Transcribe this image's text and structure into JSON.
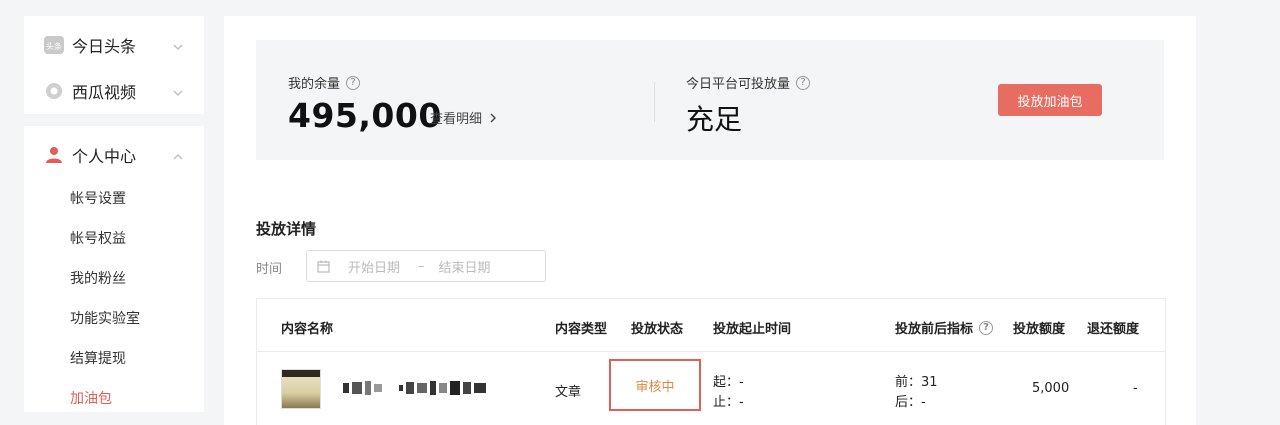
{
  "sidebar": {
    "groups": [
      {
        "label": "今日头条",
        "icon": "toutiao-logo-icon"
      },
      {
        "label": "西瓜视频",
        "icon": "xigua-logo-icon"
      }
    ],
    "personal": {
      "label": "个人中心",
      "icon": "user-icon",
      "items": [
        {
          "label": "帐号设置"
        },
        {
          "label": "帐号权益"
        },
        {
          "label": "我的粉丝"
        },
        {
          "label": "功能实验室"
        },
        {
          "label": "结算提现"
        },
        {
          "label": "加油包",
          "active": true
        }
      ]
    }
  },
  "balance": {
    "my_label": "我的余量",
    "my_value": "495,000",
    "detail_link": "查看明细",
    "platform_label": "今日平台可投放量",
    "platform_value": "充足",
    "cta": "投放加油包"
  },
  "details": {
    "title": "投放详情",
    "time_label": "时间",
    "start_placeholder": "开始日期",
    "separator": "–",
    "end_placeholder": "结束日期"
  },
  "table": {
    "headers": {
      "name": "内容名称",
      "type": "内容类型",
      "status": "投放状态",
      "period": "投放起止时间",
      "metrics": "投放前后指标",
      "amount": "投放额度",
      "refund": "退还额度"
    },
    "rows": [
      {
        "type": "文章",
        "status": "审核中",
        "start_label": "起：",
        "start": "-",
        "end_label": "止：",
        "end": "-",
        "before_label": "前：",
        "before": "31",
        "after_label": "后：",
        "after": "-",
        "amount": "5,000",
        "refund": "-"
      }
    ]
  },
  "colors": {
    "accent": "#e76d62",
    "active_nav": "#e15f56",
    "status_text": "#e0874a"
  }
}
